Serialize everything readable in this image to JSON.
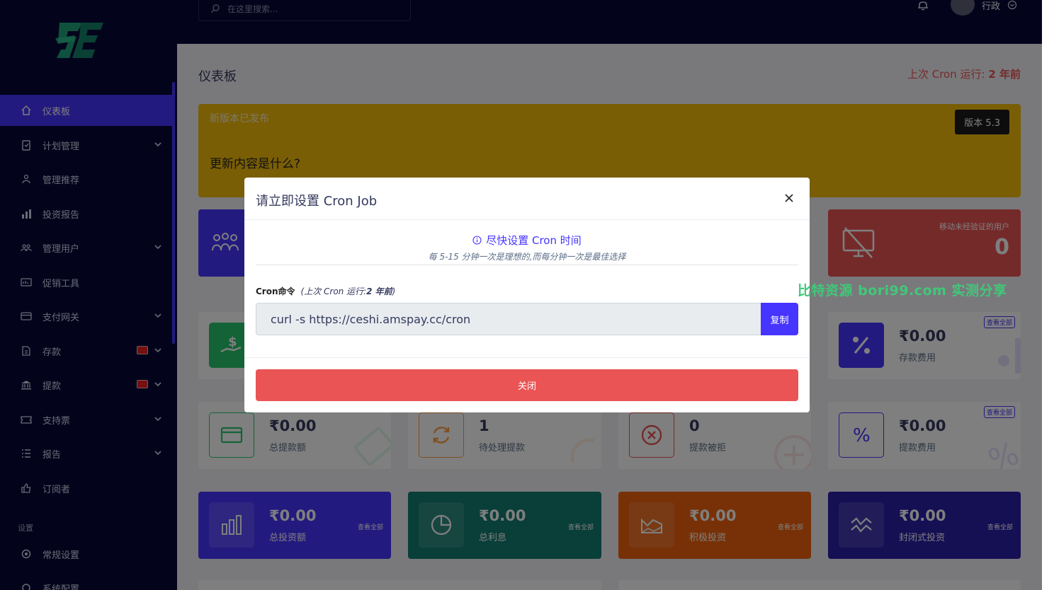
{
  "topbar": {
    "search_placeholder": "在这里搜索...",
    "user_name": "行政"
  },
  "sidebar": {
    "items": [
      {
        "label": "仪表板",
        "icon": "home-icon",
        "active": true
      },
      {
        "label": "计划管理",
        "icon": "clipboard-icon",
        "has_chevron": true
      },
      {
        "label": "管理推荐",
        "icon": "referral-icon"
      },
      {
        "label": "投资报告",
        "icon": "bar-chart-icon"
      },
      {
        "label": "管理用户",
        "icon": "users-icon",
        "has_chevron": true
      },
      {
        "label": "促销工具",
        "icon": "promo-icon"
      },
      {
        "label": "支付网关",
        "icon": "credit-card-icon",
        "has_chevron": true
      },
      {
        "label": "存款",
        "icon": "deposit-icon",
        "has_chevron": true,
        "has_badge": true
      },
      {
        "label": "提款",
        "icon": "bank-icon",
        "has_chevron": true,
        "has_badge": true
      },
      {
        "label": "支持票",
        "icon": "ticket-icon",
        "has_chevron": true
      },
      {
        "label": "报告",
        "icon": "list-icon",
        "has_chevron": true
      },
      {
        "label": "订阅者",
        "icon": "thumbs-up-icon"
      }
    ],
    "section_label": "设置",
    "settings_items": [
      {
        "label": "常规设置",
        "icon": "gear-icon"
      },
      {
        "label": "系统配置",
        "icon": "config-icon"
      }
    ]
  },
  "page": {
    "title": "仪表板",
    "cron_label": "上次 Cron 运行:",
    "cron_value": "2 年前"
  },
  "banner": {
    "title": "新版本已发布",
    "question": "更新内容是什么?",
    "version": "版本 5.3"
  },
  "widgets": {
    "unverified_mobile": {
      "label": "移动未经验证的用户",
      "value": "0"
    },
    "deposit_charge": {
      "value": "₹0.00",
      "label": "存款费用",
      "link": "查看全部"
    },
    "total_withdrawn": {
      "value": "₹0.00",
      "label": "总提款额"
    },
    "pending_withdrawals": {
      "value": "1",
      "label": "待处理提款"
    },
    "rejected_withdrawals": {
      "value": "0",
      "label": "提款被拒"
    },
    "withdrawal_charge": {
      "value": "₹0.00",
      "label": "提款费用",
      "link": "查看全部"
    },
    "total_invest": {
      "value": "₹0.00",
      "label": "总投资额",
      "link": "查看全部"
    },
    "total_interest": {
      "value": "₹0.00",
      "label": "总利息",
      "link": "查看全部"
    },
    "active_invest": {
      "value": "₹0.00",
      "label": "积极投资",
      "link": "查看全部"
    },
    "closed_invest": {
      "value": "₹0.00",
      "label": "封闭式投资",
      "link": "查看全部"
    }
  },
  "modal": {
    "title": "请立即设置 Cron Job",
    "info": "尽快设置 Cron 时间",
    "sub": "每 5-15 分钟一次是理想的,而每分钟一次是最佳选择",
    "cmd_label": "Cron命令",
    "cmd_last_prefix": "(上次 Cron 运行:",
    "cmd_last_value": "2 年前",
    "cmd_last_suffix": ")",
    "command": "curl -s https://ceshi.amspay.cc/cron",
    "copy_label": "复制",
    "close_label": "关闭"
  },
  "watermark": "比特资源 bori99.com 实测分享",
  "colors": {
    "primary": "#4634ff",
    "danger": "#ea5455",
    "warning": "#f4bd0b",
    "sidebar": "#060938"
  }
}
